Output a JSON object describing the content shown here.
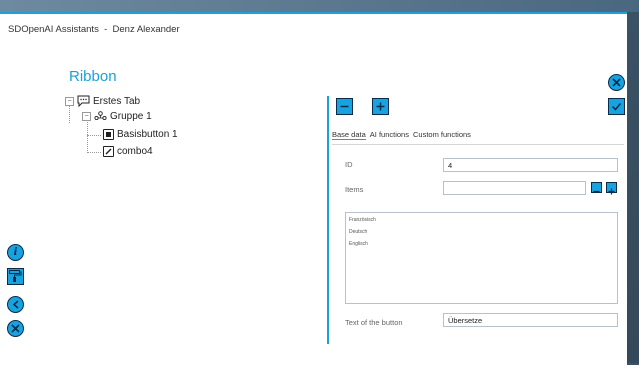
{
  "window": {
    "title": "SDOpenAI Assistants  -  Denz Alexander"
  },
  "ribbon": {
    "title": "Ribbon"
  },
  "tree": {
    "root": {
      "label": "Erstes Tab"
    },
    "group": {
      "label": "Gruppe 1"
    },
    "items": [
      {
        "label": "Basisbutton 1",
        "icon": "button-icon"
      },
      {
        "label": "combo4",
        "icon": "edit-icon"
      }
    ]
  },
  "tabs": [
    "Base data",
    "AI functions",
    "Custom functions"
  ],
  "form": {
    "id_label": "ID",
    "id_value": "4",
    "items_label": "Items",
    "items_value": "",
    "items_list": [
      "Französisch",
      "Deutsch",
      "Englisch"
    ],
    "text_label": "Text of the button",
    "text_value": "Übersetze"
  },
  "colors": {
    "accent": "#1aa1db",
    "button_fill": "#17a3e0",
    "button_border": "#0b2b4a"
  }
}
